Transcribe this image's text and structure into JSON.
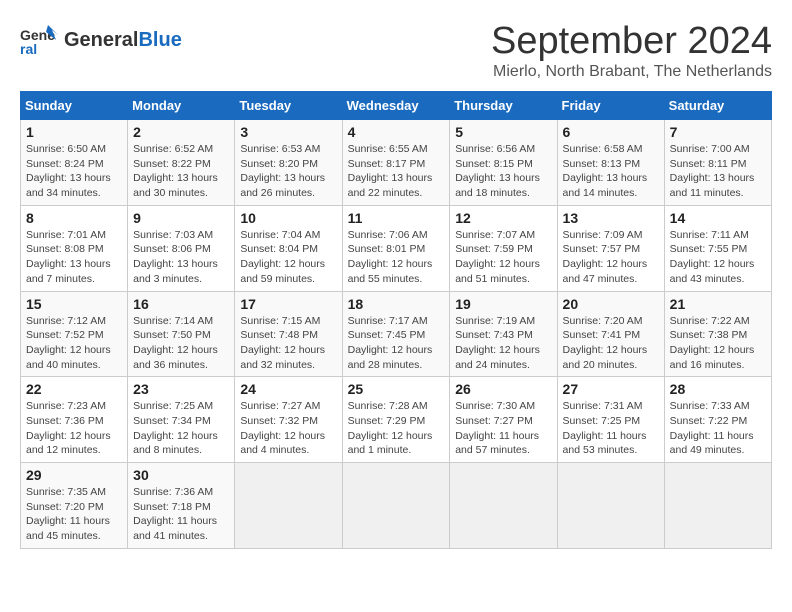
{
  "header": {
    "logo_general": "General",
    "logo_blue": "Blue",
    "month_title": "September 2024",
    "location": "Mierlo, North Brabant, The Netherlands"
  },
  "weekdays": [
    "Sunday",
    "Monday",
    "Tuesday",
    "Wednesday",
    "Thursday",
    "Friday",
    "Saturday"
  ],
  "days": [
    {
      "date": 1,
      "sunrise": "6:50 AM",
      "sunset": "8:24 PM",
      "daylight": "13 hours and 34 minutes."
    },
    {
      "date": 2,
      "sunrise": "6:52 AM",
      "sunset": "8:22 PM",
      "daylight": "13 hours and 30 minutes."
    },
    {
      "date": 3,
      "sunrise": "6:53 AM",
      "sunset": "8:20 PM",
      "daylight": "13 hours and 26 minutes."
    },
    {
      "date": 4,
      "sunrise": "6:55 AM",
      "sunset": "8:17 PM",
      "daylight": "13 hours and 22 minutes."
    },
    {
      "date": 5,
      "sunrise": "6:56 AM",
      "sunset": "8:15 PM",
      "daylight": "13 hours and 18 minutes."
    },
    {
      "date": 6,
      "sunrise": "6:58 AM",
      "sunset": "8:13 PM",
      "daylight": "13 hours and 14 minutes."
    },
    {
      "date": 7,
      "sunrise": "7:00 AM",
      "sunset": "8:11 PM",
      "daylight": "13 hours and 11 minutes."
    },
    {
      "date": 8,
      "sunrise": "7:01 AM",
      "sunset": "8:08 PM",
      "daylight": "13 hours and 7 minutes."
    },
    {
      "date": 9,
      "sunrise": "7:03 AM",
      "sunset": "8:06 PM",
      "daylight": "13 hours and 3 minutes."
    },
    {
      "date": 10,
      "sunrise": "7:04 AM",
      "sunset": "8:04 PM",
      "daylight": "12 hours and 59 minutes."
    },
    {
      "date": 11,
      "sunrise": "7:06 AM",
      "sunset": "8:01 PM",
      "daylight": "12 hours and 55 minutes."
    },
    {
      "date": 12,
      "sunrise": "7:07 AM",
      "sunset": "7:59 PM",
      "daylight": "12 hours and 51 minutes."
    },
    {
      "date": 13,
      "sunrise": "7:09 AM",
      "sunset": "7:57 PM",
      "daylight": "12 hours and 47 minutes."
    },
    {
      "date": 14,
      "sunrise": "7:11 AM",
      "sunset": "7:55 PM",
      "daylight": "12 hours and 43 minutes."
    },
    {
      "date": 15,
      "sunrise": "7:12 AM",
      "sunset": "7:52 PM",
      "daylight": "12 hours and 40 minutes."
    },
    {
      "date": 16,
      "sunrise": "7:14 AM",
      "sunset": "7:50 PM",
      "daylight": "12 hours and 36 minutes."
    },
    {
      "date": 17,
      "sunrise": "7:15 AM",
      "sunset": "7:48 PM",
      "daylight": "12 hours and 32 minutes."
    },
    {
      "date": 18,
      "sunrise": "7:17 AM",
      "sunset": "7:45 PM",
      "daylight": "12 hours and 28 minutes."
    },
    {
      "date": 19,
      "sunrise": "7:19 AM",
      "sunset": "7:43 PM",
      "daylight": "12 hours and 24 minutes."
    },
    {
      "date": 20,
      "sunrise": "7:20 AM",
      "sunset": "7:41 PM",
      "daylight": "12 hours and 20 minutes."
    },
    {
      "date": 21,
      "sunrise": "7:22 AM",
      "sunset": "7:38 PM",
      "daylight": "12 hours and 16 minutes."
    },
    {
      "date": 22,
      "sunrise": "7:23 AM",
      "sunset": "7:36 PM",
      "daylight": "12 hours and 12 minutes."
    },
    {
      "date": 23,
      "sunrise": "7:25 AM",
      "sunset": "7:34 PM",
      "daylight": "12 hours and 8 minutes."
    },
    {
      "date": 24,
      "sunrise": "7:27 AM",
      "sunset": "7:32 PM",
      "daylight": "12 hours and 4 minutes."
    },
    {
      "date": 25,
      "sunrise": "7:28 AM",
      "sunset": "7:29 PM",
      "daylight": "12 hours and 1 minute."
    },
    {
      "date": 26,
      "sunrise": "7:30 AM",
      "sunset": "7:27 PM",
      "daylight": "11 hours and 57 minutes."
    },
    {
      "date": 27,
      "sunrise": "7:31 AM",
      "sunset": "7:25 PM",
      "daylight": "11 hours and 53 minutes."
    },
    {
      "date": 28,
      "sunrise": "7:33 AM",
      "sunset": "7:22 PM",
      "daylight": "11 hours and 49 minutes."
    },
    {
      "date": 29,
      "sunrise": "7:35 AM",
      "sunset": "7:20 PM",
      "daylight": "11 hours and 45 minutes."
    },
    {
      "date": 30,
      "sunrise": "7:36 AM",
      "sunset": "7:18 PM",
      "daylight": "11 hours and 41 minutes."
    }
  ],
  "labels": {
    "sunrise": "Sunrise:",
    "sunset": "Sunset:",
    "daylight": "Daylight:"
  }
}
